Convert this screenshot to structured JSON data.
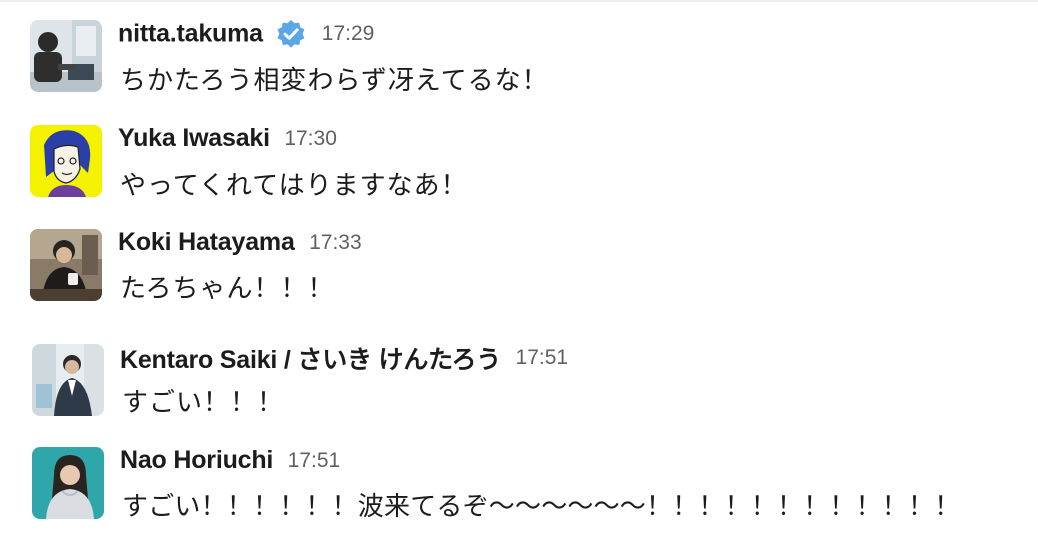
{
  "messages": [
    {
      "author": "nitta.takuma",
      "verified": true,
      "time": "17:29",
      "text": "ちかたろう相変わらず冴えてるな！"
    },
    {
      "author": "Yuka Iwasaki",
      "verified": false,
      "time": "17:30",
      "text": "やってくれてはりますなあ！"
    },
    {
      "author": "Koki Hatayama",
      "verified": false,
      "time": "17:33",
      "text": "たろちゃん！！！"
    },
    {
      "author": "Kentaro Saiki / さいき けんたろう",
      "verified": false,
      "time": "17:51",
      "text": "すごい！！！"
    },
    {
      "author": "Nao Horiuchi",
      "verified": false,
      "time": "17:51",
      "text": "すごい！！！！！！波来てるぞ〜〜〜〜〜〜！！！！！！！！！！！！"
    }
  ],
  "colors": {
    "name": "#1d1c1d",
    "timestamp": "#616061",
    "verified_badge": "#5aa6e8",
    "avatar_yellow": "#f5f200",
    "avatar_teal": "#2fa6a9"
  },
  "icons": {
    "verified": "verified-badge-icon"
  }
}
